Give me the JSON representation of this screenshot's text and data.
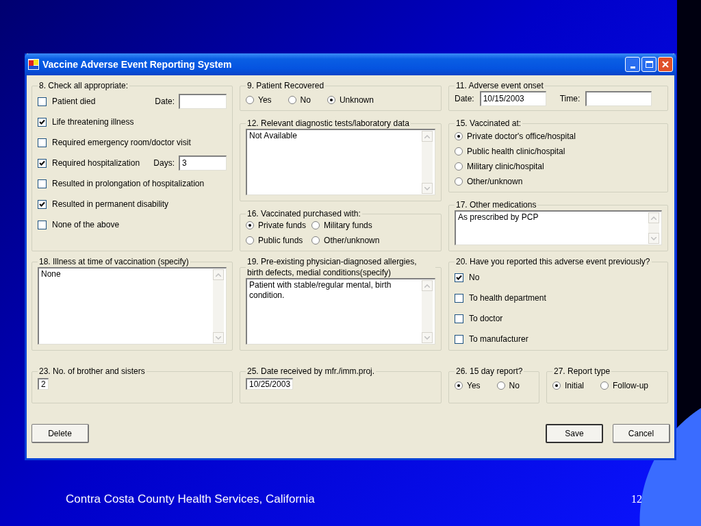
{
  "window": {
    "title": "Vaccine Adverse Event Reporting System"
  },
  "rows": [
    {
      "columns": [
        [
          {
            "kind": "checklist",
            "legend": "8. Check all appropriate:",
            "items": [
              {
                "label": "Patient died",
                "checked": false,
                "field": {
                  "label": "Date:"
                }
              },
              {
                "label": "Life threatening illness",
                "checked": true
              },
              {
                "label": "Required emergency room/doctor visit",
                "checked": false
              },
              {
                "label": "Required hospitalization",
                "checked": true,
                "field": {
                  "label": "Days:",
                  "value": "3"
                }
              },
              {
                "label": "Resulted in prolongation of hospitalization",
                "checked": false
              },
              {
                "label": "Resulted in permanent disability",
                "checked": true
              },
              {
                "label": "None of the above",
                "checked": false
              }
            ]
          }
        ],
        [
          {
            "kind": "radio-row",
            "legend": "9. Patient Recovered",
            "options": [
              {
                "label": "Yes",
                "selected": false
              },
              {
                "label": "No",
                "selected": false
              },
              {
                "label": "Unknown",
                "selected": true
              }
            ]
          },
          {
            "kind": "textarea",
            "legend": "12. Relevant diagnostic tests/laboratory data",
            "value": "Not Available"
          },
          {
            "kind": "radio-grid",
            "legend": "16. Vaccinated purchased with:",
            "options": [
              {
                "label": "Private funds",
                "selected": true
              },
              {
                "label": "Military funds",
                "selected": false
              },
              {
                "label": "Public funds",
                "selected": false
              },
              {
                "label": "Other/unknown",
                "selected": false
              }
            ]
          }
        ],
        [
          {
            "kind": "fields",
            "legend": "11. Adverse event onset",
            "fields": [
              {
                "label": "Date:",
                "value": "10/15/2003"
              },
              {
                "label": "Time:"
              }
            ]
          },
          {
            "kind": "radio-list",
            "legend": "15. Vaccinated at:",
            "options": [
              {
                "label": "Private doctor's office/hospital",
                "selected": true
              },
              {
                "label": "Public health clinic/hospital",
                "selected": false
              },
              {
                "label": "Military clinic/hospital",
                "selected": false
              },
              {
                "label": "Other/unknown",
                "selected": false
              }
            ]
          },
          {
            "kind": "textarea",
            "legend": "17. Other medications",
            "value": "As prescribed by PCP"
          }
        ]
      ]
    },
    {
      "columns": [
        [
          {
            "kind": "textarea",
            "legend": "18. Illness at time of vaccination (specify)",
            "value": "None"
          }
        ],
        [
          {
            "kind": "textarea",
            "legend": "19.  Pre-existing physician-diagnosed  allergies, birth defects, medial conditions(specify)",
            "value": "Patient with stable/regular mental, birth condition."
          }
        ],
        [
          {
            "kind": "checklist",
            "legend": "20. Have you reported this adverse event previously?",
            "items": [
              {
                "label": "No",
                "checked": true
              },
              {
                "label": "To health department",
                "checked": false
              },
              {
                "label": "To doctor",
                "checked": false
              },
              {
                "label": "To manufacturer",
                "checked": false
              }
            ]
          }
        ]
      ]
    },
    {
      "columns": [
        [
          {
            "kind": "input",
            "legend": "23. No. of brother and sisters",
            "value": "2"
          }
        ],
        [
          {
            "kind": "input",
            "legend": "25. Date received by mfr./imm.proj.",
            "value": "10/25/2003"
          }
        ],
        [
          {
            "kind": "radio-row",
            "legend": "26. 15 day report?",
            "options": [
              {
                "label": "Yes",
                "selected": true
              },
              {
                "label": "No",
                "selected": false
              }
            ]
          }
        ],
        [
          {
            "kind": "radio-row",
            "legend": "27. Report type",
            "options": [
              {
                "label": "Initial",
                "selected": true
              },
              {
                "label": "Follow-up",
                "selected": false
              }
            ]
          }
        ]
      ]
    }
  ],
  "buttons": [
    {
      "label": "Delete",
      "default": false
    },
    {
      "label": "Save",
      "default": true
    },
    {
      "label": "Cancel",
      "default": false
    }
  ],
  "slide": {
    "footer": "Contra Costa County Health Services, California",
    "page_number": "12"
  }
}
